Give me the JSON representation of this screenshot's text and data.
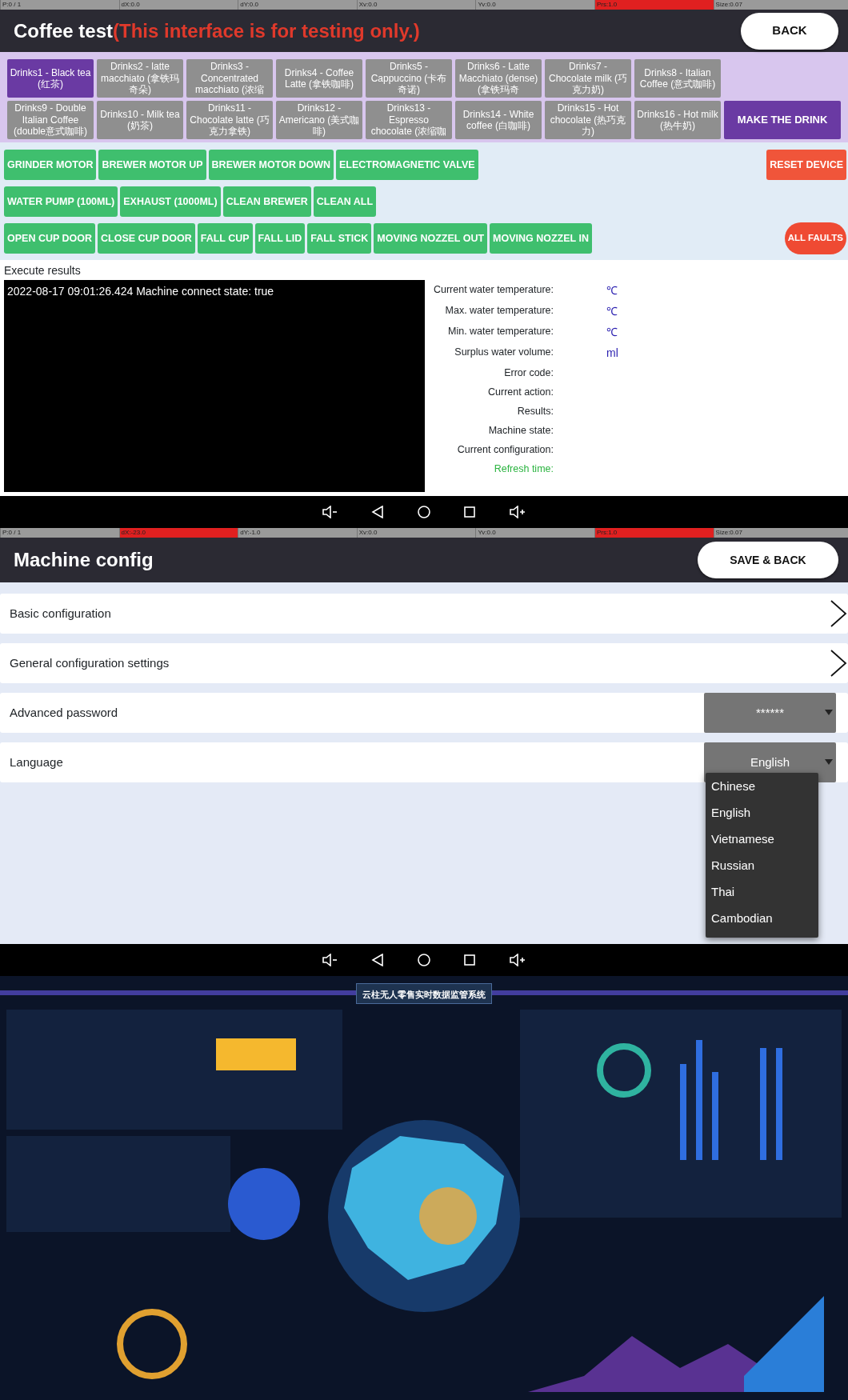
{
  "debug_bar_top": [
    {
      "text": "P:0 / 1",
      "highlighted": false
    },
    {
      "text": "dX:0.0",
      "highlighted": false
    },
    {
      "text": "dY:0.0",
      "highlighted": false
    },
    {
      "text": "Xv:0.0",
      "highlighted": false
    },
    {
      "text": "Yv:0.0",
      "highlighted": false
    },
    {
      "text": "Prs:1.0",
      "highlighted": true
    },
    {
      "text": "Size:0.07",
      "highlighted": false
    }
  ],
  "coffee_test": {
    "title": "Coffee test",
    "subtitle": "(This interface is for testing only.)",
    "back_button": "BACK",
    "drinks": [
      {
        "label": "Drinks1 - Black tea (红茶)",
        "selected": true
      },
      {
        "label": "Drinks2 - latte macchiato (拿铁玛奇朵)",
        "selected": false
      },
      {
        "label": "Drinks3 - Concentrated macchiato (浓缩",
        "selected": false
      },
      {
        "label": "Drinks4 - Coffee Latte (拿铁咖啡)",
        "selected": false
      },
      {
        "label": "Drinks5 - Cappuccino (卡布奇诺)",
        "selected": false
      },
      {
        "label": "Drinks6 - Latte Macchiato (dense) (拿铁玛奇",
        "selected": false
      },
      {
        "label": "Drinks7 - Chocolate milk (巧克力奶)",
        "selected": false
      },
      {
        "label": "Drinks8 - Italian Coffee (意式咖啡)",
        "selected": false
      },
      {
        "label": "Drinks9 - Double Italian Coffee (double意式咖啡)",
        "selected": false
      },
      {
        "label": "Drinks10 - Milk tea (奶茶)",
        "selected": false
      },
      {
        "label": "Drinks11 - Chocolate latte (巧克力拿铁)",
        "selected": false
      },
      {
        "label": "Drinks12 - Americano (美式咖啡)",
        "selected": false
      },
      {
        "label": "Drinks13 - Espresso chocolate (浓缩咖",
        "selected": false
      },
      {
        "label": "Drinks14 - White coffee (白咖啡)",
        "selected": false
      },
      {
        "label": "Drinks15 - Hot chocolate (热巧克力)",
        "selected": false
      },
      {
        "label": "Drinks16 - Hot milk (热牛奶)",
        "selected": false
      }
    ],
    "make_button": "MAKE THE DRINK",
    "action_rows": [
      [
        {
          "label": "GRINDER MOTOR",
          "kind": "action"
        },
        {
          "label": "BREWER MOTOR UP",
          "kind": "action"
        },
        {
          "label": "BREWER MOTOR DOWN",
          "kind": "action"
        },
        {
          "label": "ELECTROMAGNETIC VALVE",
          "kind": "action"
        },
        {
          "label": "RESET DEVICE",
          "kind": "danger"
        }
      ],
      [
        {
          "label": "WATER PUMP (100ML)",
          "kind": "action"
        },
        {
          "label": "EXHAUST (1000ML)",
          "kind": "action"
        },
        {
          "label": "CLEAN BREWER",
          "kind": "action"
        },
        {
          "label": "CLEAN ALL",
          "kind": "action"
        }
      ],
      [
        {
          "label": "OPEN CUP DOOR",
          "kind": "action"
        },
        {
          "label": "CLOSE CUP DOOR",
          "kind": "action"
        },
        {
          "label": "FALL CUP",
          "kind": "action"
        },
        {
          "label": "FALL LID",
          "kind": "action"
        },
        {
          "label": "FALL STICK",
          "kind": "action"
        },
        {
          "label": "MOVING NOZZEL OUT",
          "kind": "action"
        },
        {
          "label": "MOVING NOZZEL IN",
          "kind": "action"
        },
        {
          "label": "ALL FAULTS",
          "kind": "pill"
        }
      ]
    ],
    "results_heading": "Execute results",
    "log": [
      "2022-08-17 09:01:26.424  Machine connect state: true"
    ],
    "status": [
      {
        "label": "Current water temperature:",
        "unit": "℃",
        "kind": "normal"
      },
      {
        "label": "Max. water temperature:",
        "unit": "℃",
        "kind": "normal"
      },
      {
        "label": "Min. water temperature:",
        "unit": "℃",
        "kind": "normal"
      },
      {
        "label": "Surplus water volume:",
        "unit": "ml",
        "kind": "normal"
      },
      {
        "label": "Error code:",
        "kind": "normal"
      },
      {
        "label": "Current action:",
        "kind": "normal"
      },
      {
        "label": "Results:",
        "kind": "normal"
      },
      {
        "label": "Machine state:",
        "kind": "normal"
      },
      {
        "label": "Current configuration:",
        "kind": "normal"
      },
      {
        "label": "Refresh time:",
        "kind": "highlight"
      }
    ]
  },
  "debug_bar_bottom": [
    {
      "text": "P:0 / 1",
      "highlighted": false
    },
    {
      "text": "dX:-23.0",
      "highlighted": true
    },
    {
      "text": "dY:-1.0",
      "highlighted": false
    },
    {
      "text": "Xv:0.0",
      "highlighted": false
    },
    {
      "text": "Yv:0.0",
      "highlighted": false
    },
    {
      "text": "Prs:1.0",
      "highlighted": true
    },
    {
      "text": "Size:0.07",
      "highlighted": false
    }
  ],
  "machine_config": {
    "title": "Machine config",
    "save_button": "SAVE & BACK",
    "rows": [
      {
        "label": "Basic configuration",
        "kind": "link"
      },
      {
        "label": "General configuration settings",
        "kind": "link"
      },
      {
        "label": "Advanced password",
        "kind": "select",
        "value": "******"
      },
      {
        "label": "Language",
        "kind": "select",
        "value": "English"
      }
    ],
    "dropdown_options": [
      "Chinese",
      "English",
      "Vietnamese",
      "Russian",
      "Thai",
      "Cambodian"
    ]
  },
  "dashboard": {
    "title": "云柱无人零售实时数据监管系统"
  }
}
